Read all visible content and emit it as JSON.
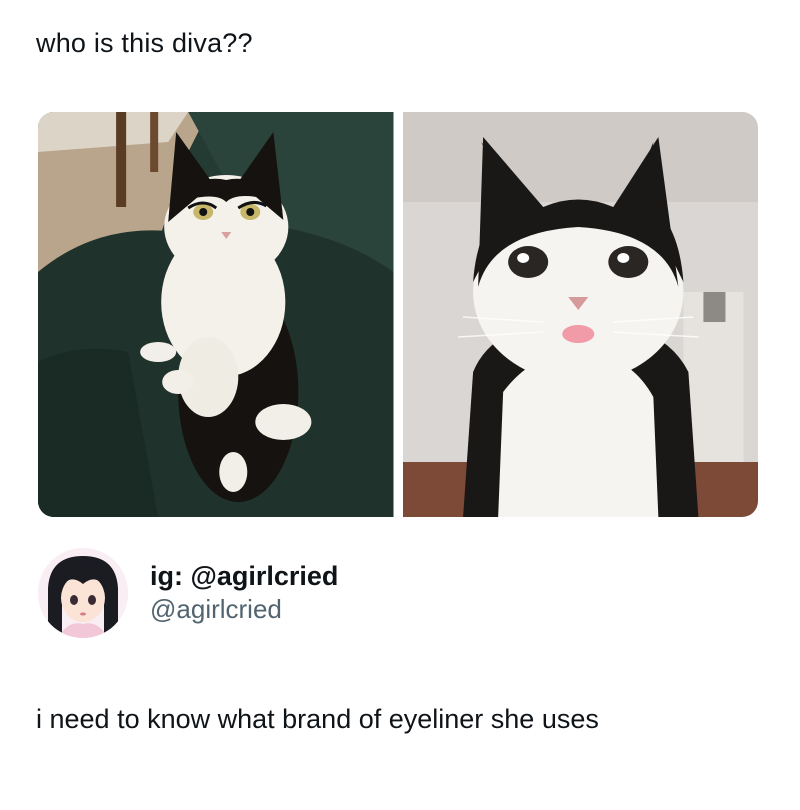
{
  "post": {
    "text": "who is this diva??",
    "images": [
      {
        "icon": "cat-photo-couch"
      },
      {
        "icon": "cat-photo-closeup"
      }
    ]
  },
  "author": {
    "display_name": "ig: @agirlcried",
    "handle": "@agirlcried",
    "avatar": "anime-girl-avatar"
  },
  "reply": {
    "text": "i need to know what brand of eyeliner she uses"
  },
  "colors": {
    "text": "#0f1419",
    "secondary": "#536471",
    "background": "#ffffff"
  }
}
